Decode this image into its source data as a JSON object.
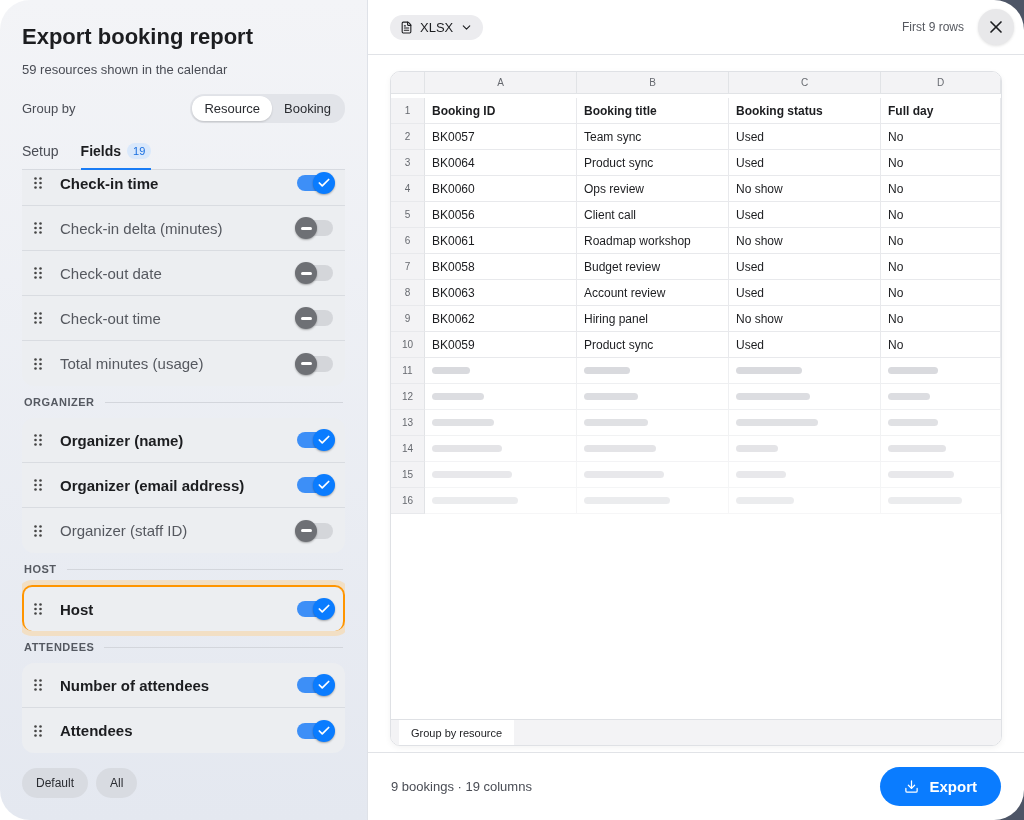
{
  "title": "Export booking report",
  "subtitle": "59 resources shown in the calendar",
  "group_by": {
    "label": "Group by",
    "options": [
      {
        "label": "Resource",
        "selected": true
      },
      {
        "label": "Booking",
        "selected": false
      }
    ]
  },
  "tabs": [
    {
      "label": "Setup",
      "selected": false
    },
    {
      "label": "Fields",
      "selected": true,
      "badge": "19"
    }
  ],
  "field_groups": [
    {
      "items": [
        {
          "label": "Check-in time",
          "on": true,
          "focused": false
        },
        {
          "label": "Check-in delta (minutes)",
          "on": false,
          "focused": false
        },
        {
          "label": "Check-out date",
          "on": false,
          "focused": false
        },
        {
          "label": "Check-out time",
          "on": false,
          "focused": false
        },
        {
          "label": "Total minutes (usage)",
          "on": false,
          "focused": false
        }
      ]
    },
    {
      "title": "ORGANIZER",
      "items": [
        {
          "label": "Organizer (name)",
          "on": true,
          "focused": false
        },
        {
          "label": "Organizer (email address)",
          "on": true,
          "focused": false
        },
        {
          "label": "Organizer (staff ID)",
          "on": false,
          "focused": false
        }
      ]
    },
    {
      "title": "HOST",
      "items": [
        {
          "label": "Host",
          "on": true,
          "focused": true
        }
      ]
    },
    {
      "title": "ATTENDEES",
      "items": [
        {
          "label": "Number of attendees",
          "on": true,
          "focused": false
        },
        {
          "label": "Attendees",
          "on": true,
          "focused": false
        }
      ]
    }
  ],
  "footer_buttons": [
    "Default",
    "All"
  ],
  "format": {
    "label": "XLSX"
  },
  "preview_note": "First 9 rows",
  "sheet": {
    "column_letters": [
      "A",
      "B",
      "C",
      "D"
    ],
    "header_row": {
      "number": "1",
      "cells": [
        "Booking ID",
        "Booking title",
        "Booking status",
        "Full day"
      ]
    },
    "rows": [
      {
        "number": "2",
        "cells": [
          "BK0057",
          "Team sync",
          "Used",
          "No"
        ]
      },
      {
        "number": "3",
        "cells": [
          "BK0064",
          "Product sync",
          "Used",
          "No"
        ]
      },
      {
        "number": "4",
        "cells": [
          "BK0060",
          "Ops review",
          "No show",
          "No"
        ]
      },
      {
        "number": "5",
        "cells": [
          "BK0056",
          "Client call",
          "Used",
          "No"
        ]
      },
      {
        "number": "6",
        "cells": [
          "BK0061",
          "Roadmap workshop",
          "No show",
          "No"
        ]
      },
      {
        "number": "7",
        "cells": [
          "BK0058",
          "Budget review",
          "Used",
          "No"
        ]
      },
      {
        "number": "8",
        "cells": [
          "BK0063",
          "Account review",
          "Used",
          "No"
        ]
      },
      {
        "number": "9",
        "cells": [
          "BK0062",
          "Hiring panel",
          "No show",
          "No"
        ]
      },
      {
        "number": "10",
        "cells": [
          "BK0059",
          "Product sync",
          "Used",
          "No"
        ]
      }
    ],
    "placeholder_rows": [
      "11",
      "12",
      "13",
      "14",
      "15",
      "16"
    ],
    "sheet_tabs": [
      {
        "label": "Group by resource",
        "selected": true
      }
    ]
  },
  "summary": "9 bookings · 19 columns",
  "export_button": "Export"
}
